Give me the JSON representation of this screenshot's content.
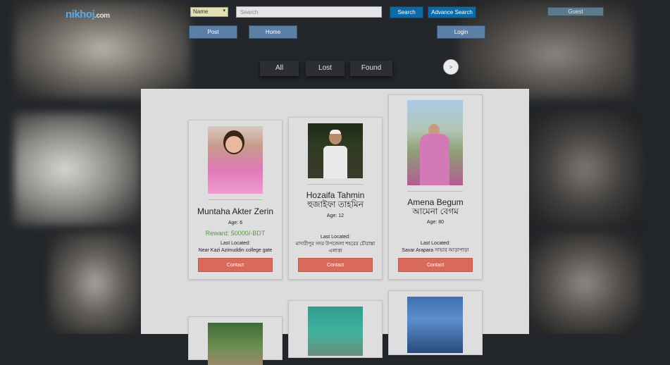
{
  "header": {
    "logo_main": "nikhoj",
    "logo_domain": ".com",
    "search_type": "Name",
    "search_placeholder": "Search",
    "search_button": "Search",
    "advance_search_button": "Advance Search",
    "guest_label": "Guest"
  },
  "nav": {
    "post": "Post",
    "home": "Home",
    "login": "Login"
  },
  "filters": {
    "all": "All",
    "lost": "Lost",
    "found": "Found",
    "next": ">"
  },
  "cards": [
    {
      "name": "Muntaha Akter Zerin",
      "age": "Age: 6",
      "reward": "Reward: 50000/-BDT",
      "last_located_label": "Last Located:",
      "location": "Near Kazi Azimuddin college gate",
      "contact": "Contact"
    },
    {
      "name": "Hozaifa Tahmin",
      "name_bn": "হুজাইফা তাহমিন",
      "age": "Age: 12",
      "last_located_label": "Last Located:",
      "location": "মাদারীপুর সদর উপজেলা শহরের চৌরাস্তা এলাকা",
      "contact": "Contact"
    },
    {
      "name": "Amena Begum",
      "name_bn": "আমেনা বেগম",
      "age": "Age: 80",
      "last_located_label": "Last Located:",
      "location": "Savar Arapara সাভার আড়াপাড়া",
      "contact": "Contact"
    }
  ],
  "colors": {
    "primary_button": "#0f6aa3",
    "nav_button": "#5c7fa6",
    "contact_button": "#d9695a",
    "reward_text": "#4f9a3f"
  }
}
